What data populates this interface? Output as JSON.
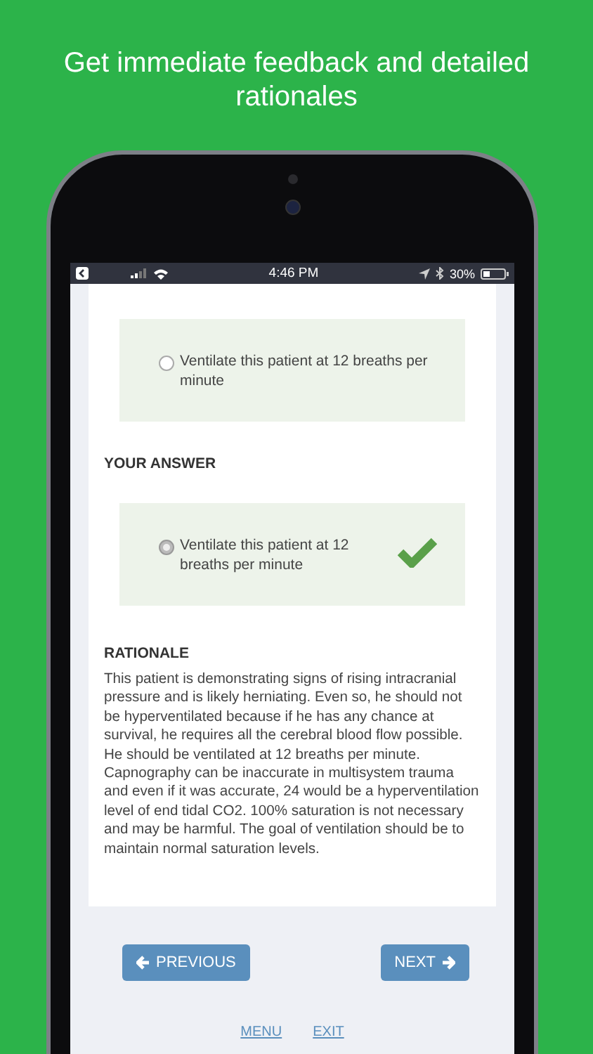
{
  "headline": "Get immediate feedback and detailed rationales",
  "status_bar": {
    "time": "4:46 PM",
    "battery": "30%"
  },
  "options": [
    {
      "text": "Ventilate this patient at 12 breaths per minute",
      "selected": false,
      "correct": false
    }
  ],
  "your_answer": {
    "heading": "YOUR ANSWER",
    "text": "Ventilate this patient at 12 breaths per minute",
    "selected": true,
    "correct": true
  },
  "rationale": {
    "heading": "RATIONALE",
    "text": "This patient is demonstrating signs of rising intracranial pressure and is likely herniating. Even so, he should not be hyperventilated because if he has any chance at survival, he requires all the cerebral blood flow possible. He should be ventilated at 12 breaths per minute. Capnography can be inaccurate in multisystem trauma and even if it was accurate, 24 would be a hyperventilation level of end tidal CO2. 100% saturation is not necessary and may be harmful. The goal of ventilation should be to maintain normal saturation levels."
  },
  "buttons": [
    {
      "label": "PREVIOUS",
      "kind": "previous"
    },
    {
      "label": "NEXT",
      "kind": "next"
    }
  ],
  "links": [
    "MENU",
    "EXIT"
  ]
}
